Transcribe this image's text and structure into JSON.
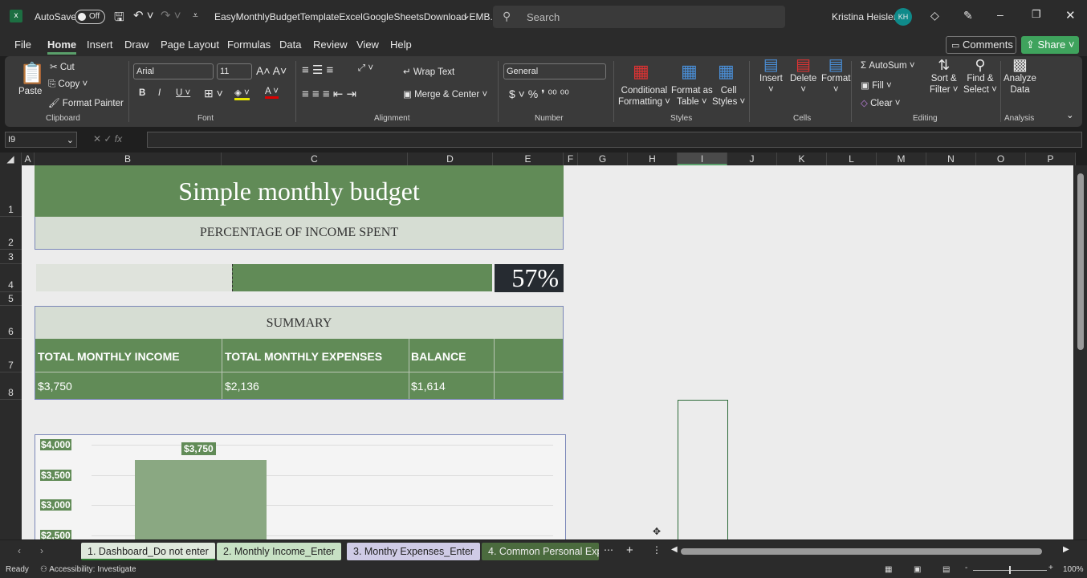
{
  "titlebar": {
    "autosave": "AutoSave",
    "toggle": "Off",
    "filename": "EasyMonthlyBudgetTemplateExcelGoogleSheetsDownload EMB...",
    "search": "Search",
    "user": "Kristina Heisler",
    "initials": "KH"
  },
  "menu": [
    "File",
    "Home",
    "Insert",
    "Draw",
    "Page Layout",
    "Formulas",
    "Data",
    "Review",
    "View",
    "Help"
  ],
  "actions": {
    "comments": "Comments",
    "share": "Share"
  },
  "ribbon": {
    "paste": "Paste",
    "cut": "Cut",
    "copy": "Copy",
    "format_painter": "Format Painter",
    "clipboard": "Clipboard",
    "font_name": "Arial",
    "font_size": "11",
    "font": "Font",
    "wrap": "Wrap Text",
    "merge": "Merge & Center",
    "alignment": "Alignment",
    "number_format": "General",
    "number": "Number",
    "cond1": "Conditional",
    "cond2": "Formatting",
    "fmt1": "Format as",
    "fmt2": "Table",
    "cs1": "Cell",
    "cs2": "Styles",
    "styles": "Styles",
    "insert": "Insert",
    "delete": "Delete",
    "format": "Format",
    "cells": "Cells",
    "autosum": "AutoSum",
    "fill": "Fill",
    "clear": "Clear",
    "sort1": "Sort &",
    "sort2": "Filter",
    "find1": "Find &",
    "find2": "Select",
    "editing": "Editing",
    "an1": "Analyze",
    "an2": "Data",
    "analysis": "Analysis"
  },
  "formula_bar": {
    "name_box": "I9",
    "formula": ""
  },
  "columns": [
    "A",
    "B",
    "C",
    "D",
    "E",
    "F",
    "G",
    "H",
    "I",
    "J",
    "K",
    "L",
    "M",
    "N",
    "O",
    "P"
  ],
  "rows": [
    "1",
    "2",
    "3",
    "4",
    "5",
    "6",
    "7",
    "8"
  ],
  "sheet": {
    "title": "Simple monthly budget",
    "subtitle": "PERCENTAGE OF INCOME SPENT",
    "percent": "57%",
    "percent_value": 57,
    "summary": "SUMMARY",
    "headers": [
      "TOTAL MONTHLY INCOME",
      "TOTAL MONTHLY EXPENSES",
      "BALANCE"
    ],
    "values": [
      "$3,750",
      "$2,136",
      "$1,614"
    ]
  },
  "chart_data": {
    "type": "bar",
    "y_ticks": [
      "$4,000",
      "$3,500",
      "$3,000",
      "$2,500"
    ],
    "values": [
      3750
    ],
    "data_labels": [
      "$3,750"
    ],
    "grid": true,
    "color": "#8aa882"
  },
  "tabs": [
    "1. Dashboard_Do not enter",
    "2. Monthly Income_Enter",
    "3. Monthy Expenses_Enter",
    "4. Common Personal Exp"
  ],
  "status": {
    "ready": "Ready",
    "accessibility": "Accessibility: Investigate",
    "zoom": "100%"
  }
}
